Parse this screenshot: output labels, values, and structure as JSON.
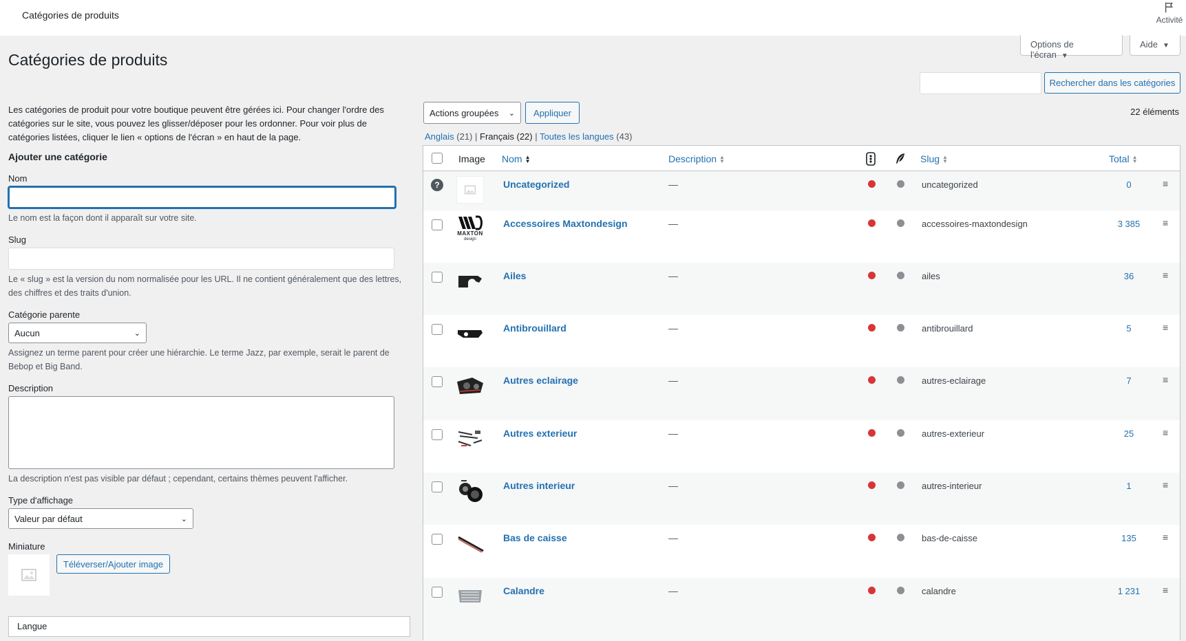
{
  "topbar": {
    "title": "Catégories de produits",
    "activity_label": "Activité"
  },
  "screen_options": {
    "options_label": "Options de l'écran",
    "help_label": "Aide"
  },
  "page": {
    "title": "Catégories de produits"
  },
  "search": {
    "button_label": "Rechercher dans les catégories",
    "value": ""
  },
  "form": {
    "intro": "Les catégories de produit pour votre boutique peuvent être gérées ici. Pour changer l'ordre des catégories sur le site, vous pouvez les glisser/déposer pour les ordonner. Pour voir plus de catégories listées, cliquer le lien « options de l'écran » en haut de la page.",
    "heading": "Ajouter une catégorie",
    "name_label": "Nom",
    "name_help": "Le nom est la façon dont il apparaît sur votre site.",
    "slug_label": "Slug",
    "slug_help": "Le « slug » est la version du nom normalisée pour les URL. Il ne contient généralement que des lettres, des chiffres et des traits d'union.",
    "parent_label": "Catégorie parente",
    "parent_value": "Aucun",
    "parent_help": "Assignez un terme parent pour créer une hiérarchie. Le terme Jazz, par exemple, serait le parent de Bebop et Big Band.",
    "description_label": "Description",
    "description_help": "La description n'est pas visible par défaut ; cependant, certains thèmes peuvent l'afficher.",
    "display_label": "Type d'affichage",
    "display_value": "Valeur par défaut",
    "thumbnail_label": "Miniature",
    "upload_label": "Téléverser/Ajouter image",
    "language_label": "Langue"
  },
  "list": {
    "bulk_actions": "Actions groupées",
    "apply_label": "Appliquer",
    "count": "22 éléments",
    "languages": [
      {
        "name": "Anglais",
        "count": "(21)"
      },
      {
        "name": "Français",
        "count": "(22)"
      },
      {
        "name": "Toutes les langues",
        "count": "(43)"
      }
    ],
    "columns": {
      "image": "Image",
      "name": "Nom",
      "description": "Description",
      "slug": "Slug",
      "total": "Total"
    },
    "rows": [
      {
        "name": "Uncategorized",
        "description": "—",
        "slug": "uncategorized",
        "count": "0",
        "thumb": "placeholder"
      },
      {
        "name": "Accessoires Maxtondesign",
        "description": "—",
        "slug": "accessoires-maxtondesign",
        "count": "3 385",
        "thumb": "maxton-logo",
        "logo_text": "MAXTON",
        "logo_sub": "design"
      },
      {
        "name": "Ailes",
        "description": "—",
        "slug": "ailes",
        "count": "36",
        "thumb": "fender"
      },
      {
        "name": "Antibrouillard",
        "description": "—",
        "slug": "antibrouillard",
        "count": "5",
        "thumb": "foglight"
      },
      {
        "name": "Autres eclairage",
        "description": "—",
        "slug": "autres-eclairage",
        "count": "7",
        "thumb": "headlight"
      },
      {
        "name": "Autres exterieur",
        "description": "—",
        "slug": "autres-exterieur",
        "count": "25",
        "thumb": "exterior-kit"
      },
      {
        "name": "Autres interieur",
        "description": "—",
        "slug": "autres-interieur",
        "count": "1",
        "thumb": "gauge"
      },
      {
        "name": "Bas de caisse",
        "description": "—",
        "slug": "bas-de-caisse",
        "count": "135",
        "thumb": "side-skirt"
      },
      {
        "name": "Calandre",
        "description": "—",
        "slug": "calandre",
        "count": "1 231",
        "thumb": "grille"
      }
    ]
  },
  "colors": {
    "link": "#2271b1",
    "status_red": "#d63638",
    "status_gray": "#8c8f94",
    "background": "#f0f0f1"
  }
}
